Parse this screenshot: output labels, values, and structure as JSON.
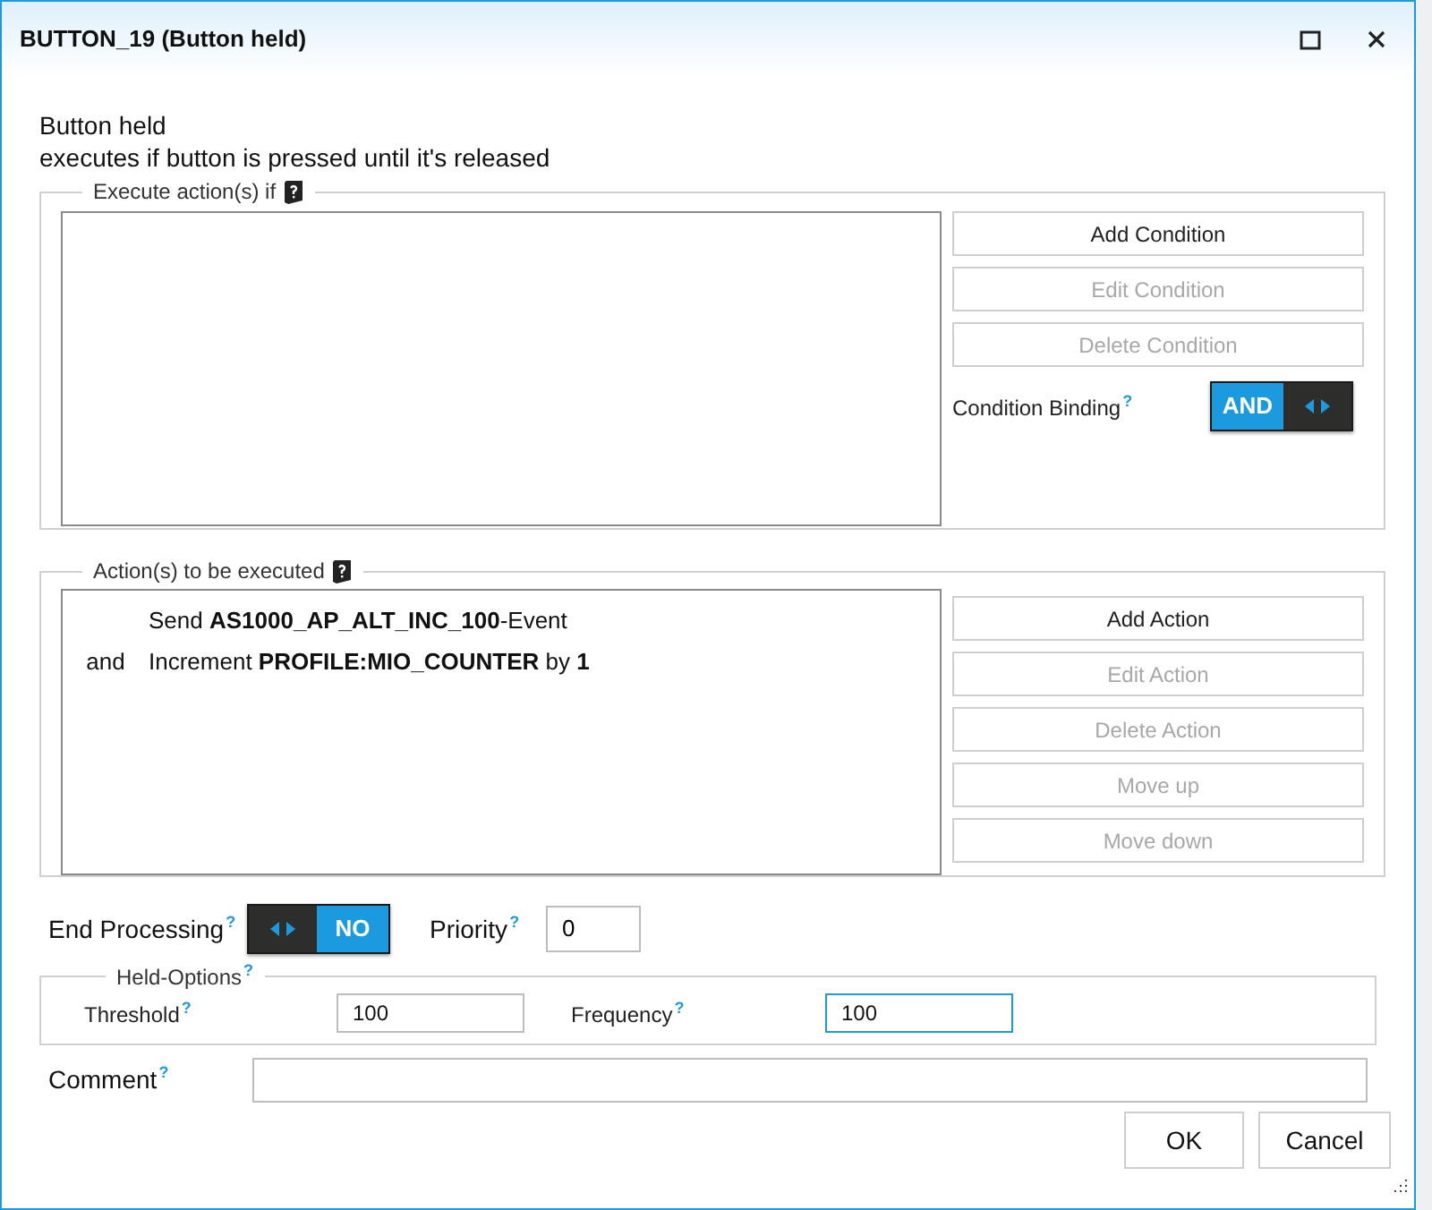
{
  "window": {
    "title": "BUTTON_19 (Button held)"
  },
  "description": [
    "Button held",
    "executes if button is pressed until it's released"
  ],
  "conditions": {
    "label": "Execute action(s) if",
    "buttons": [
      {
        "label": "Add Condition",
        "disabled": false
      },
      {
        "label": "Edit Condition",
        "disabled": true
      },
      {
        "label": "Delete Condition",
        "disabled": true
      }
    ],
    "binding": {
      "label": "Condition Binding",
      "help": "?",
      "value": "AND",
      "value_first": true
    }
  },
  "actions": {
    "label": "Action(s) to be executed",
    "rows": [
      {
        "prefix": "",
        "text": "Send **AS1000_AP_ALT_INC_100**-Event"
      },
      {
        "prefix": "and",
        "text": "Increment **PROFILE:MIO_COUNTER** by **1**"
      }
    ],
    "buttons": [
      {
        "label": "Add Action",
        "disabled": false
      },
      {
        "label": "Edit Action",
        "disabled": true
      },
      {
        "label": "Delete Action",
        "disabled": true
      },
      {
        "label": "Move up",
        "disabled": true
      },
      {
        "label": "Move down",
        "disabled": true
      }
    ]
  },
  "end_processing": {
    "label": "End Processing",
    "help": "?",
    "value": "NO",
    "value_first": false
  },
  "priority": {
    "label": "Priority",
    "help": "?",
    "value": "0"
  },
  "held_options": {
    "label": "Held-Options",
    "help": "?",
    "fields": [
      {
        "label": "Threshold",
        "help": "?",
        "value": "100",
        "focused": false
      },
      {
        "label": "Frequency",
        "help": "?",
        "value": "100",
        "focused": true
      }
    ]
  },
  "comment": {
    "label": "Comment",
    "help": "?"
  },
  "buttons": [
    "OK",
    "Cancel"
  ]
}
